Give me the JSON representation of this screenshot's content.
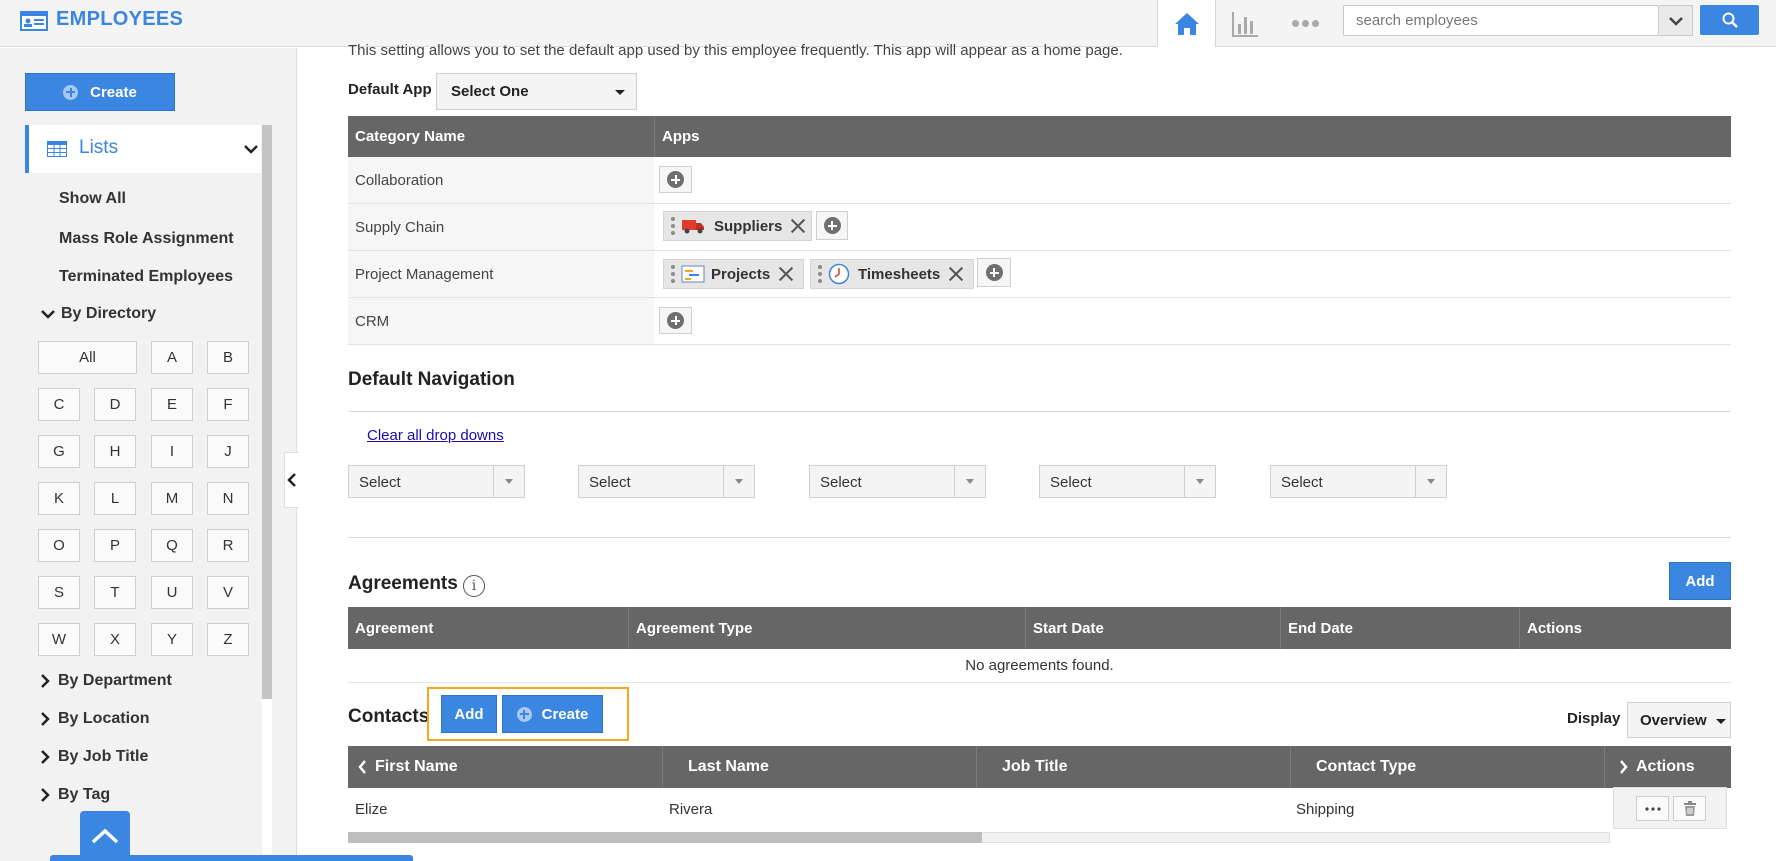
{
  "header": {
    "app_title": "EMPLOYEES",
    "search": {
      "placeholder": "search employees"
    },
    "icons": [
      "home-icon",
      "bar-chart-icon",
      "more-icon",
      "chevron-down-icon",
      "search-icon"
    ],
    "accent_color": "#3b86e0"
  },
  "sidebar": {
    "create_label": "Create",
    "lists_label": "Lists",
    "links": [
      "Show All",
      "Mass Role Assignment",
      "Terminated Employees"
    ],
    "by_directory_label": "By Directory",
    "directory_letters": [
      "All",
      "A",
      "B",
      "C",
      "D",
      "E",
      "F",
      "G",
      "H",
      "I",
      "J",
      "K",
      "L",
      "M",
      "N",
      "O",
      "P",
      "Q",
      "R",
      "S",
      "T",
      "U",
      "V",
      "W",
      "X",
      "Y",
      "Z"
    ],
    "groups": [
      "By Department",
      "By Location",
      "By Job Title",
      "By Tag"
    ]
  },
  "main": {
    "intro_text": "This setting allows you to set the default app used by this employee frequently. This app will appear as a home page.",
    "default_app": {
      "label": "Default App",
      "value": "Select One"
    },
    "category_table": {
      "headers": [
        "Category Name",
        "Apps"
      ],
      "rows": [
        {
          "name": "Collaboration",
          "apps": []
        },
        {
          "name": "Supply Chain",
          "apps": [
            "Suppliers"
          ]
        },
        {
          "name": "Project Management",
          "apps": [
            "Projects",
            "Timesheets"
          ]
        },
        {
          "name": "CRM",
          "apps": []
        }
      ]
    },
    "default_navigation": {
      "title": "Default Navigation",
      "clear_link": "Clear all drop downs",
      "selects": [
        "Select",
        "Select",
        "Select",
        "Select",
        "Select"
      ]
    },
    "agreements": {
      "title": "Agreements",
      "add_label": "Add",
      "headers": [
        "Agreement",
        "Agreement Type",
        "Start Date",
        "End Date",
        "Actions"
      ],
      "empty_message": "No agreements found."
    },
    "contacts": {
      "title": "Contacts",
      "add_label": "Add",
      "create_label": "Create",
      "display_label": "Display",
      "display_value": "Overview",
      "headers": [
        "First Name",
        "Last Name",
        "Job Title",
        "Contact Type",
        "Actions"
      ],
      "rows": [
        {
          "first_name": "Elize",
          "last_name": "Rivera",
          "job_title": "",
          "contact_type": "Shipping"
        }
      ],
      "highlight_color": "#f5a623"
    }
  }
}
